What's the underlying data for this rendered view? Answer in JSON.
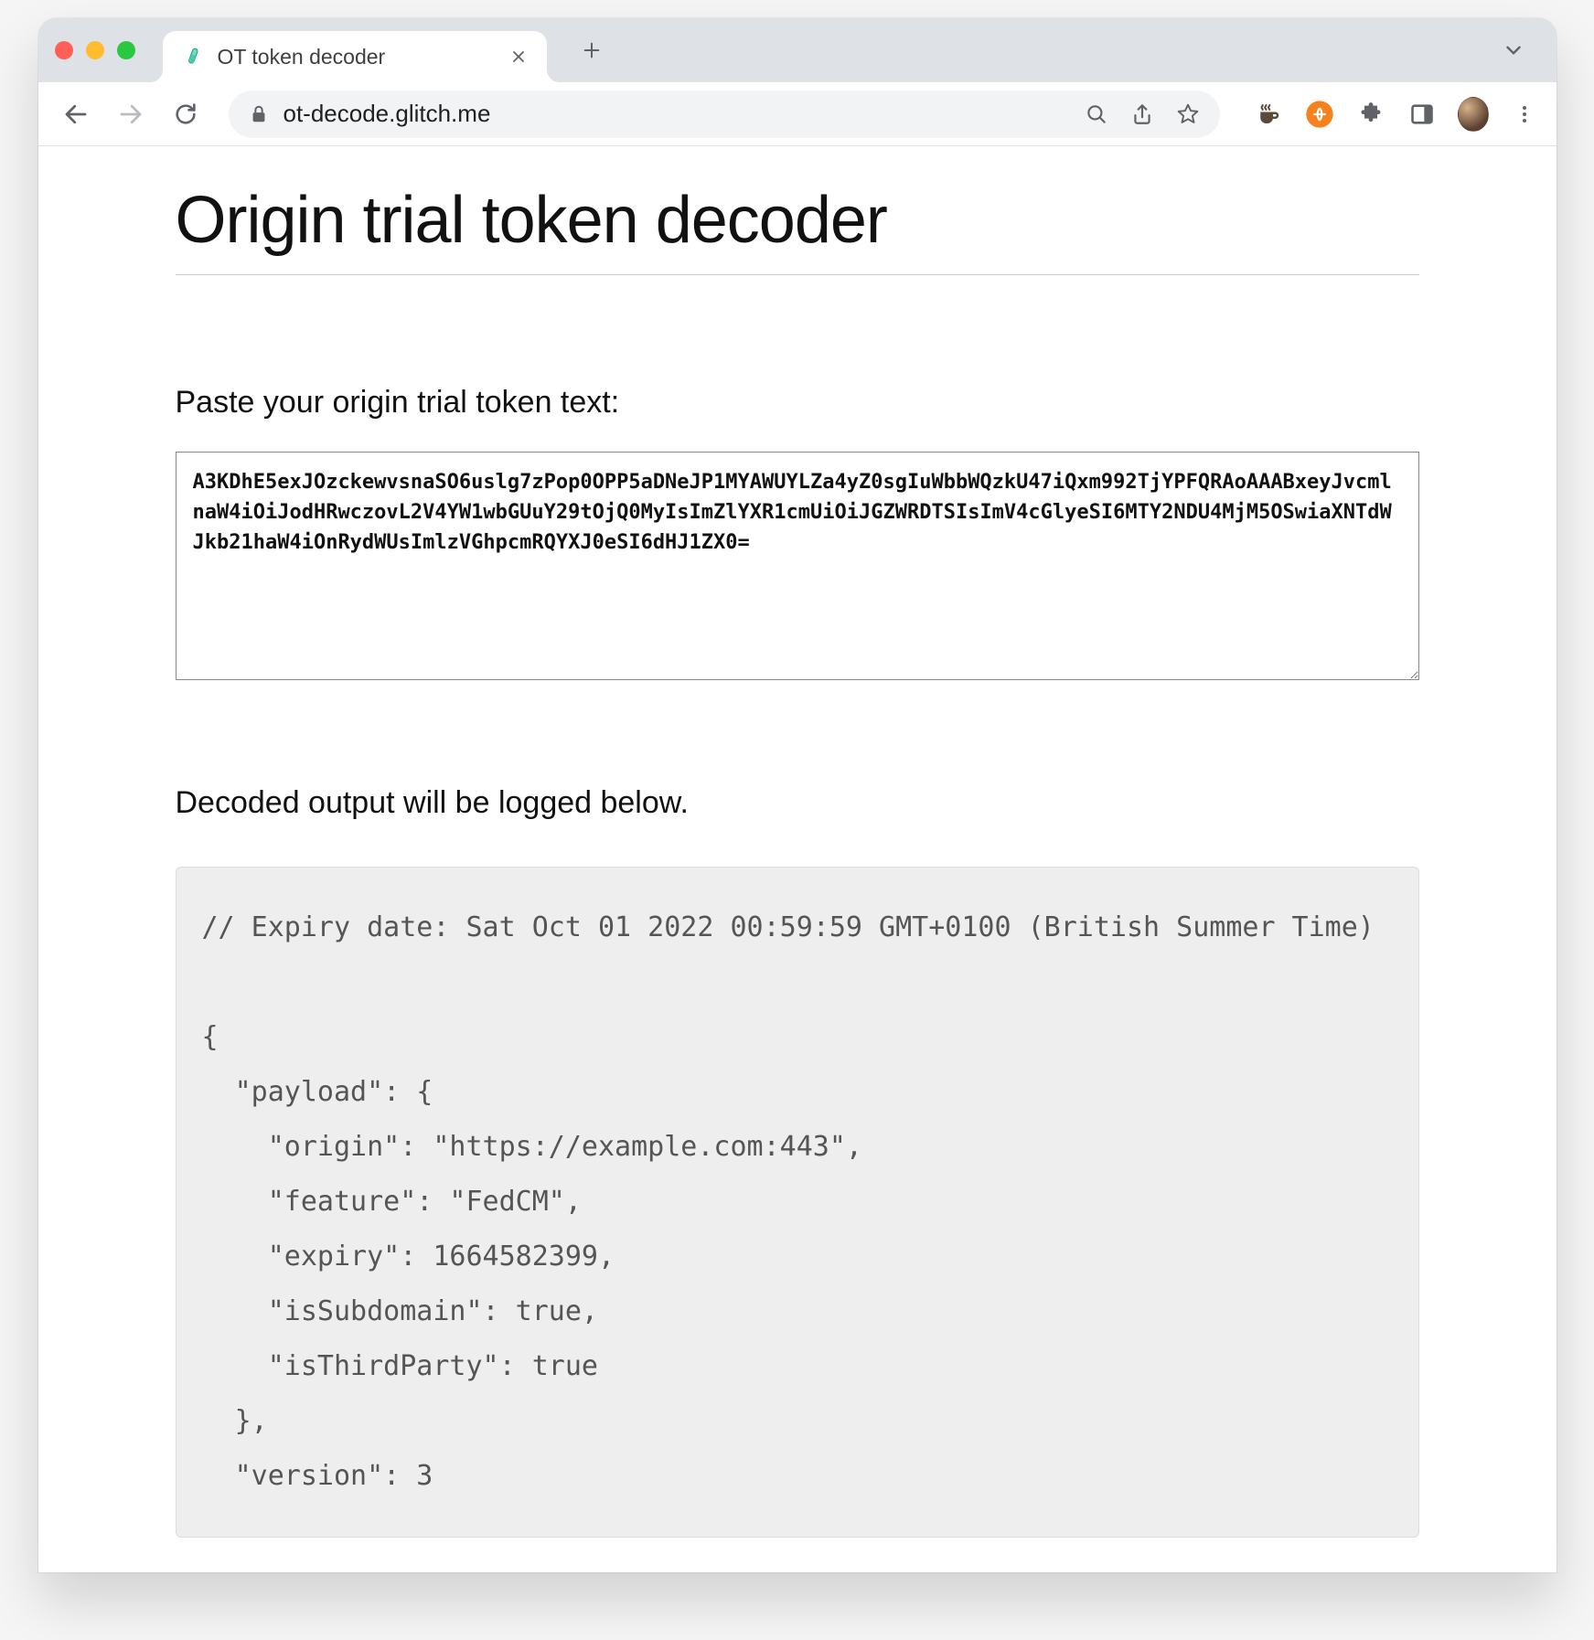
{
  "browser": {
    "tab": {
      "title": "OT token decoder",
      "favicon": "test-tube-icon"
    },
    "url": "ot-decode.glitch.me"
  },
  "page": {
    "heading": "Origin trial token decoder",
    "paste_label": "Paste your origin trial token text:",
    "token_value": "A3KDhE5exJOzckewvsnaSO6uslg7zPop0OPP5aDNeJP1MYAWUYLZa4yZ0sgIuWbbWQzkU47iQxm992TjYPFQRAoAAABxeyJvcmlnaW4iOiJodHRwczovL2V4YW1wbGUuY29tOjQ0MyIsImZlYXR1cmUiOiJGZWRDTSIsImV4cGlyeSI6MTY2NDU4MjM5OSwiaXNTdWJkb21haW4iOnRydWUsImlzVGhpcmRQYXJ0eSI6dHJ1ZX0=",
    "output_label": "Decoded output will be logged below.",
    "output_text": "// Expiry date: Sat Oct 01 2022 00:59:59 GMT+0100 (British Summer Time)\n\n{\n  \"payload\": {\n    \"origin\": \"https://example.com:443\",\n    \"feature\": \"FedCM\",\n    \"expiry\": 1664582399,\n    \"isSubdomain\": true,\n    \"isThirdParty\": true\n  },\n  \"version\": 3"
  },
  "decoded": {
    "expiry_date_string": "Sat Oct 01 2022 00:59:59 GMT+0100 (British Summer Time)",
    "payload": {
      "origin": "https://example.com:443",
      "feature": "FedCM",
      "expiry": 1664582399,
      "isSubdomain": true,
      "isThirdParty": true
    },
    "version": 3
  }
}
